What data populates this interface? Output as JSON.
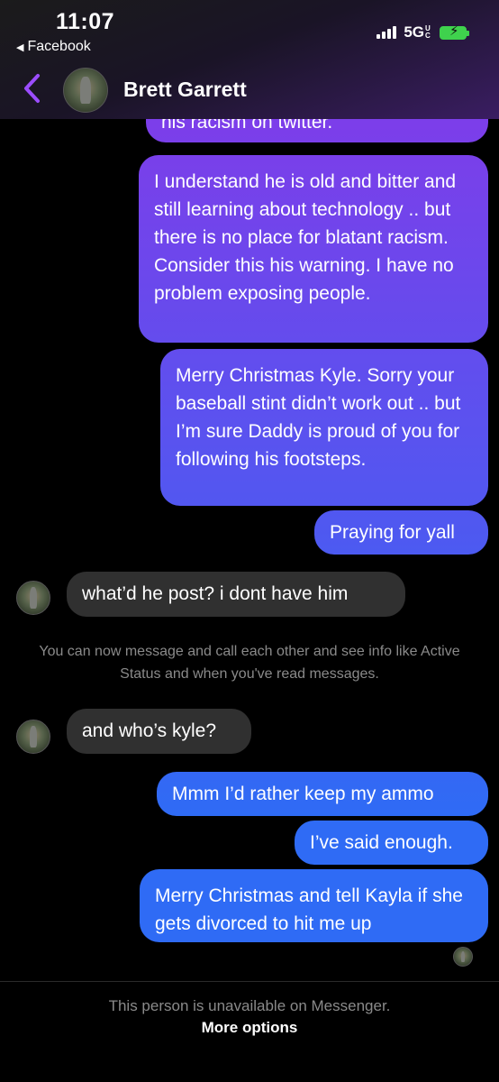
{
  "status_bar": {
    "time": "11:07",
    "back_app": "Facebook",
    "network": "5G",
    "network_suffix": "UC"
  },
  "header": {
    "contact_name": "Brett Garrett"
  },
  "messages": [
    {
      "id": "m0",
      "direction": "outgoing",
      "text": "his racism on twitter."
    },
    {
      "id": "m1",
      "direction": "outgoing",
      "text": "I understand he is old and bitter and still learning about technology .. but there is no place for blatant racism. Consider this his warning. I have no problem exposing people."
    },
    {
      "id": "m2",
      "direction": "outgoing",
      "text": "Merry Christmas Kyle. Sorry your baseball stint didn’t work out .. but I’m sure Daddy is proud of you for following his footsteps."
    },
    {
      "id": "m3",
      "direction": "outgoing",
      "text": "Praying for yall"
    },
    {
      "id": "m4",
      "direction": "incoming",
      "text": "what’d he post? i dont have him"
    },
    {
      "id": "m5",
      "direction": "incoming",
      "text": "and who’s kyle?"
    },
    {
      "id": "m6",
      "direction": "outgoing",
      "text": "Mmm I’d rather keep my ammo"
    },
    {
      "id": "m7",
      "direction": "outgoing",
      "text": "I’ve said enough."
    },
    {
      "id": "m8",
      "direction": "outgoing",
      "text": "Merry Christmas and tell Kayla if she gets divorced to hit me up"
    }
  ],
  "system_notice": "You can now message and call each other and see info like Active Status and when you've read messages.",
  "footer": {
    "unavailable_note": "This person is unavailable on Messenger.",
    "more_options": "More options"
  },
  "colors": {
    "outgoing_top": "#8a36e8",
    "outgoing_bottom": "#2f6bf5",
    "incoming": "#303030",
    "accent": "#9b4dff"
  }
}
